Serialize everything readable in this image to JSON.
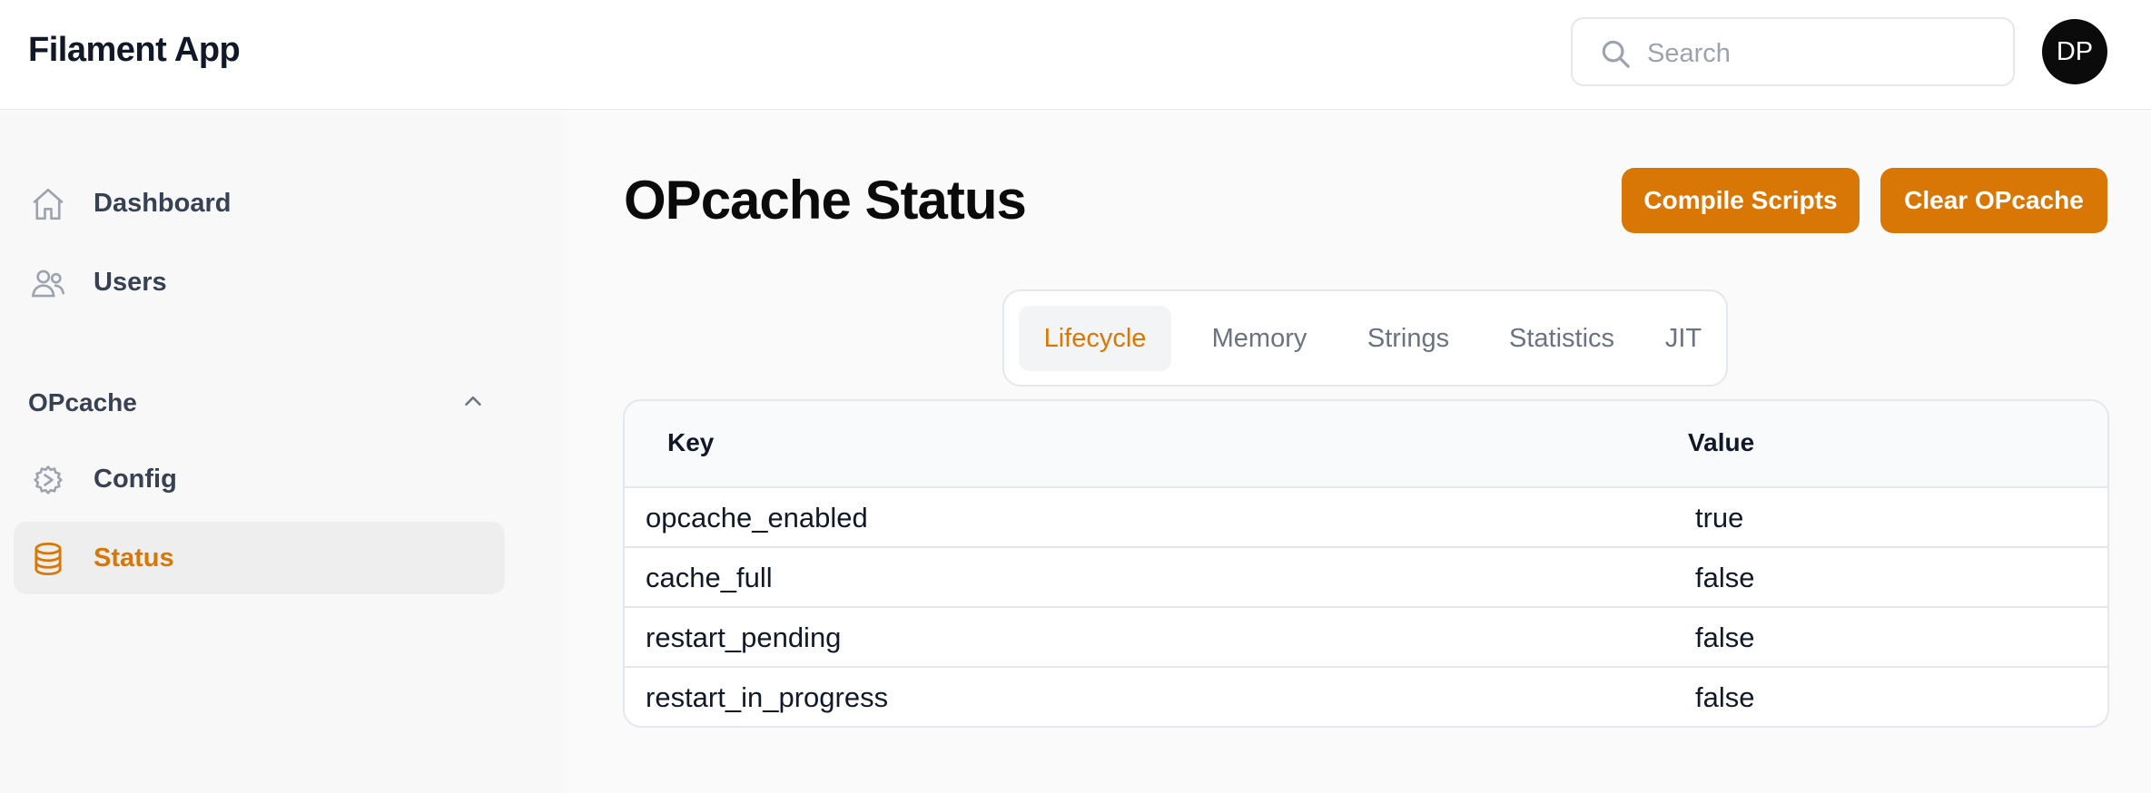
{
  "app": {
    "title": "Filament App"
  },
  "header": {
    "search": {
      "placeholder": "Search"
    },
    "avatar_initials": "DP"
  },
  "sidebar": {
    "items": [
      {
        "label": "Dashboard",
        "icon": "home-icon"
      },
      {
        "label": "Users",
        "icon": "users-icon"
      }
    ],
    "group": {
      "label": "OPcache",
      "expanded": true,
      "items": [
        {
          "label": "Config",
          "icon": "gear-icon"
        },
        {
          "label": "Status",
          "icon": "database-icon",
          "active": true
        }
      ]
    }
  },
  "page": {
    "title": "OPcache Status",
    "actions": {
      "compile": "Compile Scripts",
      "clear": "Clear OPcache"
    },
    "tabs": [
      "Lifecycle",
      "Memory",
      "Strings",
      "Statistics",
      "JIT"
    ],
    "active_tab": "Lifecycle"
  },
  "table": {
    "headers": {
      "key": "Key",
      "value": "Value"
    },
    "rows": [
      {
        "key": "opcache_enabled",
        "value": "true"
      },
      {
        "key": "cache_full",
        "value": "false"
      },
      {
        "key": "restart_pending",
        "value": "false"
      },
      {
        "key": "restart_in_progress",
        "value": "false"
      }
    ]
  },
  "colors": {
    "accent": "#d97706",
    "text": "#111827",
    "muted": "#6b7280",
    "border": "#e5e7eb"
  }
}
